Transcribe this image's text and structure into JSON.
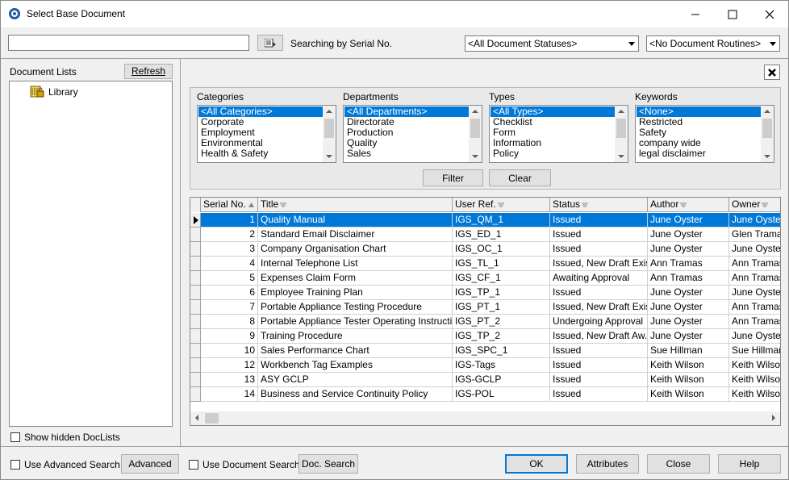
{
  "window": {
    "title": "Select Base Document"
  },
  "search": {
    "value": "",
    "mode_label": "Searching by Serial No.",
    "status_filter": "<All Document Statuses>",
    "routine_filter": "<No Document Routines>"
  },
  "left": {
    "heading": "Document Lists",
    "refresh_label": "Refresh",
    "tree_root": "Library",
    "show_hidden_label": "Show hidden DocLists"
  },
  "filters": {
    "categories": {
      "label": "Categories",
      "items": [
        "<All Categories>",
        "Corporate",
        "Employment",
        "Environmental",
        "Health & Safety"
      ]
    },
    "departments": {
      "label": "Departments",
      "items": [
        "<All Departments>",
        "Directorate",
        "Production",
        "Quality",
        "Sales"
      ]
    },
    "types": {
      "label": "Types",
      "items": [
        "<All Types>",
        "Checklist",
        "Form",
        "Information",
        "Policy"
      ]
    },
    "keywords": {
      "label": "Keywords",
      "items": [
        "<None>",
        "Restricted",
        "Safety",
        "company wide",
        "legal disclaimer"
      ]
    },
    "filter_label": "Filter",
    "clear_label": "Clear"
  },
  "grid": {
    "columns": [
      "Serial No.",
      "Title",
      "User Ref.",
      "Status",
      "Author",
      "Owner"
    ],
    "rows": [
      [
        "1",
        "Quality Manual",
        "IGS_QM_1",
        "Issued",
        "June Oyster",
        "June Oyster"
      ],
      [
        "2",
        "Standard Email Disclaimer",
        "IGS_ED_1",
        "Issued",
        "June Oyster",
        "Glen Tramas"
      ],
      [
        "3",
        "Company Organisation Chart",
        "IGS_OC_1",
        "Issued",
        "June Oyster",
        "June Oyster"
      ],
      [
        "4",
        "Internal Telephone List",
        "IGS_TL_1",
        "Issued, New Draft Exists",
        "Ann Tramas",
        "Ann Tramas"
      ],
      [
        "5",
        "Expenses Claim Form",
        "IGS_CF_1",
        "Awaiting Approval",
        "Ann Tramas",
        "Ann Tramas"
      ],
      [
        "6",
        "Employee Training Plan",
        "IGS_TP_1",
        "Issued",
        "June Oyster",
        "June Oyster"
      ],
      [
        "7",
        "Portable Appliance Testing Procedure",
        "IGS_PT_1",
        "Issued, New Draft Exists",
        "June Oyster",
        "Ann Tramas"
      ],
      [
        "8",
        "Portable Appliance Tester Operating Instructions",
        "IGS_PT_2",
        "Undergoing Approval",
        "June Oyster",
        "Ann Tramas"
      ],
      [
        "9",
        "Training Procedure",
        "IGS_TP_2",
        "Issued, New Draft Aw...",
        "June Oyster",
        "June Oyster"
      ],
      [
        "10",
        "Sales Performance Chart",
        "IGS_SPC_1",
        "Issued",
        "Sue Hillman",
        "Sue Hillman"
      ],
      [
        "12",
        "Workbench Tag Examples",
        "IGS-Tags",
        "Issued",
        "Keith Wilson",
        "Keith Wilson"
      ],
      [
        "13",
        "ASY GCLP",
        "IGS-GCLP",
        "Issued",
        "Keith Wilson",
        "Keith Wilson"
      ],
      [
        "14",
        "Business and Service Continuity Policy",
        "IGS-POL",
        "Issued",
        "Keith Wilson",
        "Keith Wilson"
      ]
    ]
  },
  "bottom": {
    "use_advanced_search_label": "Use Advanced Search",
    "advanced_label": "Advanced",
    "use_doc_search_label": "Use Document Search",
    "doc_search_label": "Doc. Search",
    "ok_label": "OK",
    "attributes_label": "Attributes",
    "close_label": "Close",
    "help_label": "Help"
  }
}
